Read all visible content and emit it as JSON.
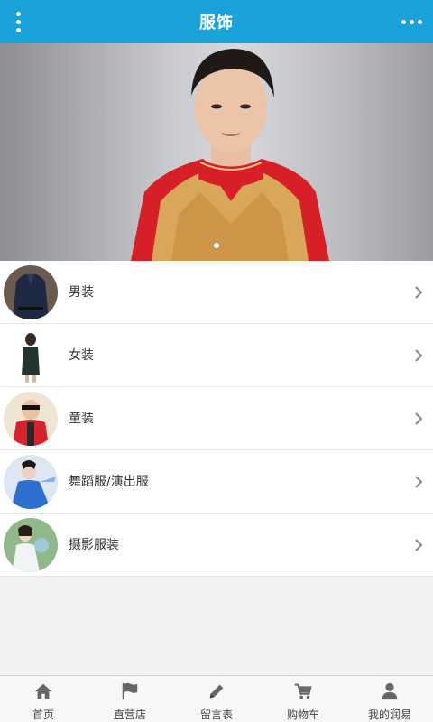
{
  "header": {
    "title": "服饰",
    "menu_icon": "vertical-dots-icon",
    "more_icon": "horizontal-dots-icon",
    "color": "#1aa3d8"
  },
  "banner": {
    "slide_index": 1,
    "slide_count": 1
  },
  "categories": [
    {
      "label": "男装",
      "icon": "mens-clothing-thumb"
    },
    {
      "label": "女装",
      "icon": "womens-clothing-thumb"
    },
    {
      "label": "童装",
      "icon": "kids-clothing-thumb"
    },
    {
      "label": "舞蹈服/演出服",
      "icon": "dance-costume-thumb"
    },
    {
      "label": "摄影服装",
      "icon": "photography-costume-thumb"
    }
  ],
  "tabbar": {
    "items": [
      {
        "label": "首页",
        "icon": "home-icon"
      },
      {
        "label": "直营店",
        "icon": "flag-icon"
      },
      {
        "label": "留言表",
        "icon": "pencil-icon"
      },
      {
        "label": "购物车",
        "icon": "cart-icon"
      },
      {
        "label": "我的润易",
        "icon": "user-icon"
      }
    ]
  }
}
